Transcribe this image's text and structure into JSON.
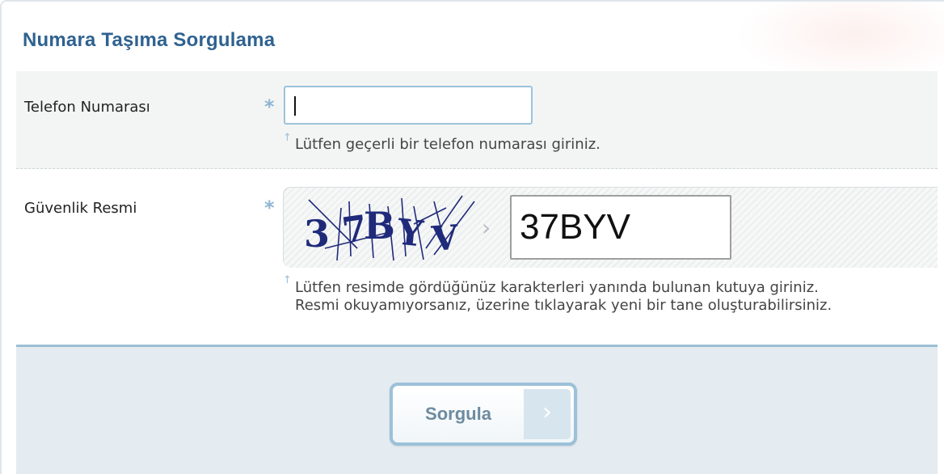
{
  "page": {
    "title": "Numara Taşıma Sorgulama"
  },
  "phone_field": {
    "label": "Telefon Numarası",
    "required_marker": "*",
    "value": "",
    "hint": "Lütfen geçerli bir telefon numarası giriniz."
  },
  "security_field": {
    "label": "Güvenlik Resmi",
    "required_marker": "*",
    "captcha_text": "37BYV",
    "value": "37BYV",
    "hint_line1": "Lütfen resimde gördüğünüz karakterleri yanında bulunan kutuya giriniz.",
    "hint_line2": "Resmi okuyamıyorsanız, üzerine tıklayarak yeni bir tane oluşturabilirsiniz."
  },
  "submit": {
    "label": "Sorgula",
    "arrow": "›"
  },
  "colors": {
    "title": "#2f6290",
    "accent_border": "#9cc1d8",
    "footer_bg": "#e4ebf1",
    "captcha_ink": "#1f2a7a"
  },
  "icons": {
    "required": "asterisk-icon",
    "hint": "up-arrow-hint-icon",
    "separator": "chevron-right-icon",
    "submit": "chevron-right-icon"
  }
}
